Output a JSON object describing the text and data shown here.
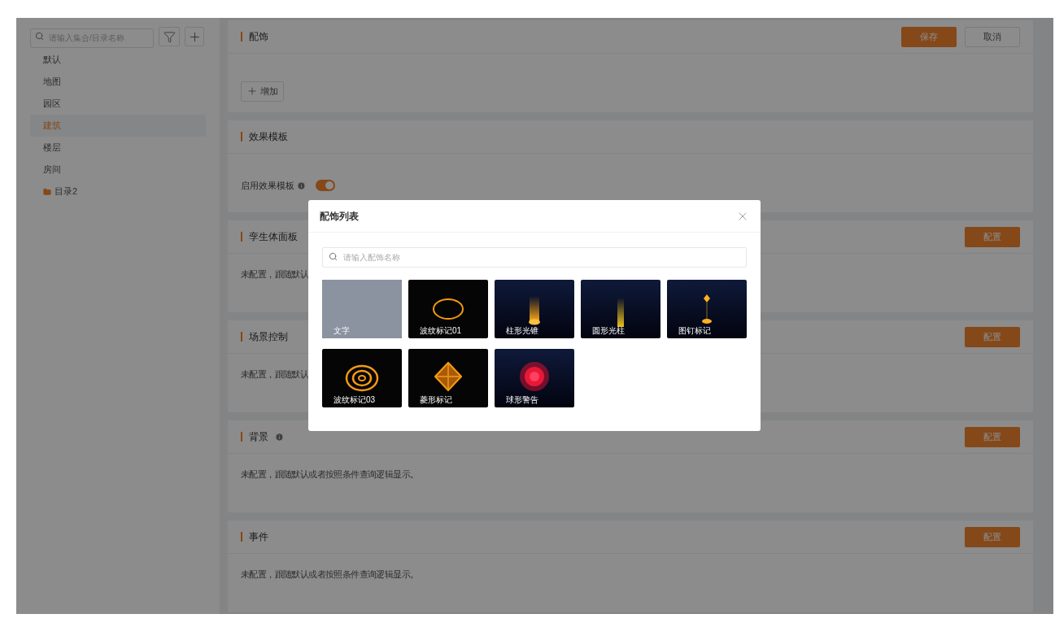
{
  "sidebar": {
    "search": {
      "placeholder": "请输入集合/目录名称"
    },
    "items": [
      {
        "label": "默认",
        "kind": "item",
        "selected": false
      },
      {
        "label": "地图",
        "kind": "item",
        "selected": false
      },
      {
        "label": "园区",
        "kind": "item",
        "selected": false
      },
      {
        "label": "建筑",
        "kind": "item",
        "selected": true
      },
      {
        "label": "楼层",
        "kind": "item",
        "selected": false
      },
      {
        "label": "房间",
        "kind": "item",
        "selected": false
      },
      {
        "label": "目录2",
        "kind": "folder",
        "selected": false
      }
    ]
  },
  "sections": [
    {
      "title": "配饰",
      "header_buttons": [
        {
          "label": "保存",
          "kind": "primary"
        },
        {
          "label": "取消",
          "kind": "default"
        }
      ],
      "add_button": "增加"
    },
    {
      "title": "效果模板",
      "toggle": {
        "label": "启用效果模板",
        "info": true,
        "on": true
      }
    },
    {
      "title": "孪生体面板",
      "config_button": "配置",
      "note": "未配置，跟随默认"
    },
    {
      "title": "场景控制",
      "config_button": "配置",
      "note": "未配置，跟随默认"
    },
    {
      "title": "背景",
      "info": true,
      "config_button": "配置",
      "note": "未配置，跟随默认或者按照条件查询逻辑显示。"
    },
    {
      "title": "事件",
      "config_button": "配置",
      "note": "未配置，跟随默认或者按照条件查询逻辑显示。"
    }
  ],
  "modal": {
    "title": "配饰列表",
    "search": {
      "placeholder": "请输入配饰名称"
    },
    "items": [
      {
        "label": "文字",
        "kind": "scene"
      },
      {
        "label": "波纹标记01",
        "kind": "ring"
      },
      {
        "label": "柱形光锥",
        "kind": "cone"
      },
      {
        "label": "圆形光柱",
        "kind": "pillar"
      },
      {
        "label": "图钉标记",
        "kind": "pin"
      },
      {
        "label": "波纹标记03",
        "kind": "rings"
      },
      {
        "label": "菱形标记",
        "kind": "diamond"
      },
      {
        "label": "球形警告",
        "kind": "sphere"
      }
    ]
  }
}
